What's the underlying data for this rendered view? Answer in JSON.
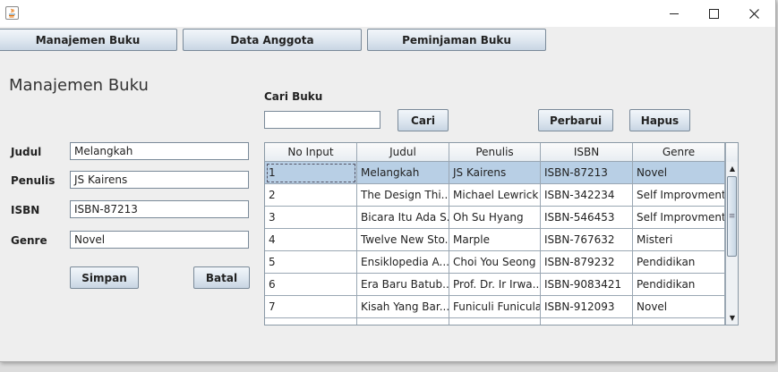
{
  "window": {
    "controls": {
      "minimize": "—",
      "maximize": "☐",
      "close": "✕"
    }
  },
  "nav": {
    "tabs": [
      {
        "label": "Manajemen Buku"
      },
      {
        "label": "Data Anggota"
      },
      {
        "label": "Peminjaman Buku"
      }
    ]
  },
  "form": {
    "heading": "Manajemen Buku",
    "judul_label": "Judul",
    "judul_value": "Melangkah",
    "penulis_label": "Penulis",
    "penulis_value": "JS Kairens",
    "isbn_label": "ISBN",
    "isbn_value": "ISBN-87213",
    "genre_label": "Genre",
    "genre_value": "Novel",
    "simpan_label": "Simpan",
    "batal_label": "Batal"
  },
  "search": {
    "label": "Cari Buku",
    "value": "",
    "cari_label": "Cari",
    "perbarui_label": "Perbarui",
    "hapus_label": "Hapus"
  },
  "table": {
    "columns": [
      "No Input",
      "Judul",
      "Penulis",
      "ISBN",
      "Genre"
    ],
    "rows": [
      [
        "1",
        "Melangkah",
        "JS Kairens",
        "ISBN-87213",
        "Novel"
      ],
      [
        "2",
        "The Design Thi...",
        "Michael Lewrick",
        "ISBN-342234",
        "Self Improvment"
      ],
      [
        "3",
        "Bicara Itu Ada S...",
        "Oh Su Hyang",
        "ISBN-546453",
        "Self Improvment"
      ],
      [
        "4",
        "Twelve New Sto...",
        "Marple",
        "ISBN-767632",
        "Misteri"
      ],
      [
        "5",
        "Ensiklopedia A...",
        "Choi You Seong",
        "ISBN-879232",
        "Pendidikan"
      ],
      [
        "6",
        "Era Baru Batub...",
        "Prof. Dr. Ir Irwa...",
        "ISBN-9083421",
        "Pendidikan"
      ],
      [
        "7",
        "Kisah Yang Bar...",
        "Funiculi Funicula",
        "ISBN-912093",
        "Novel"
      ]
    ],
    "selected_row": 0,
    "scroll": {
      "up": "▲",
      "down": "▼",
      "grip": "≡"
    }
  },
  "colors": {
    "selection": "#b8cfe5",
    "window_bg": "#eeeeee",
    "button_border": "#7a8a99"
  },
  "icons": [
    "java-icon",
    "minimize-icon",
    "maximize-icon",
    "close-icon",
    "scroll-up-icon",
    "scroll-down-icon"
  ]
}
